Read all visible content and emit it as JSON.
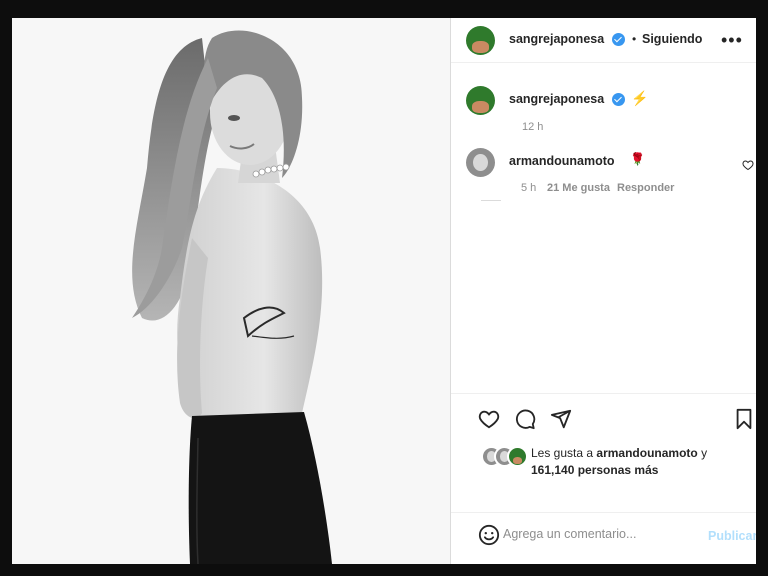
{
  "post": {
    "author": "sangrejaponesa",
    "follow_sep": "•",
    "follow_status": "Siguiendo",
    "more_icon": "more-horizontal-icon"
  },
  "caption": {
    "author": "sangrejaponesa",
    "emoji": "⚡",
    "time": "12 h"
  },
  "comments": [
    {
      "author": "armandounamoto",
      "emoji": "🌹",
      "time": "5 h",
      "likes": "21 Me gusta",
      "reply": "Responder"
    }
  ],
  "actions": {
    "like_icon": "heart-icon",
    "comment_icon": "comment-icon",
    "share_icon": "share-icon",
    "save_icon": "bookmark-icon"
  },
  "likes": {
    "prefix": "Les gusta a ",
    "user": "armandounamoto",
    "middle": " y",
    "count": "161,140 personas más"
  },
  "comment_box": {
    "placeholder": "Agrega un comentario...",
    "publish": "Publicar",
    "emoji_icon": "smiley-icon"
  },
  "colors": {
    "verified": "#3897f0",
    "publish_disabled": "#b2dffc",
    "muted_text": "#8e8e8e"
  }
}
